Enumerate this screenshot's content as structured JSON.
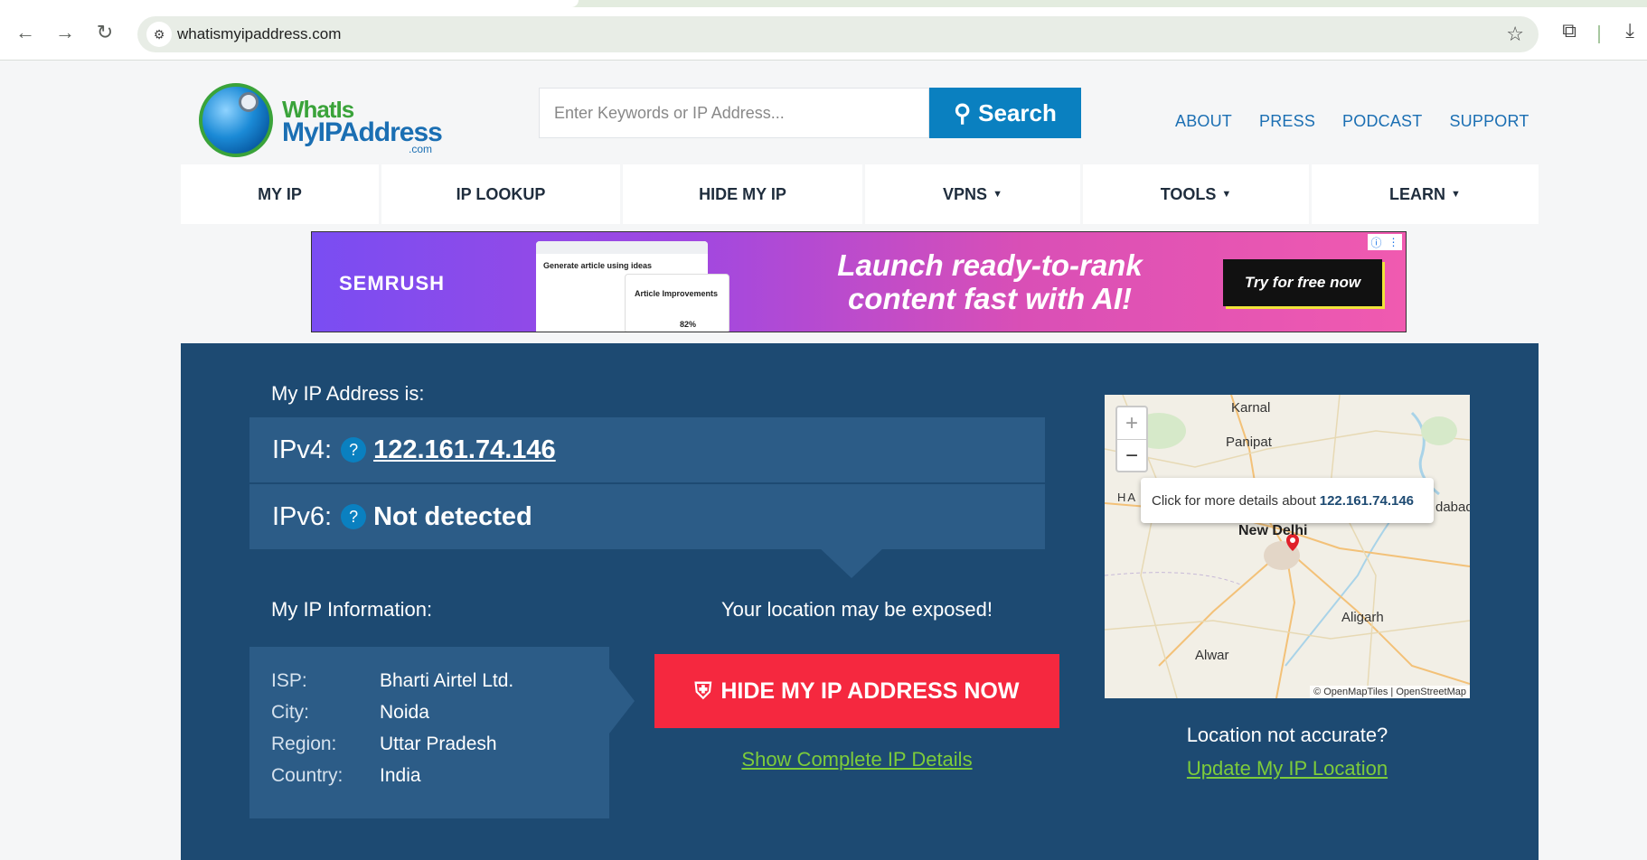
{
  "browser": {
    "url": "whatismyipaddress.com",
    "back_icon": "←",
    "forward_icon": "→",
    "reload_icon": "↻",
    "site_icon": "⚙",
    "star_icon": "☆",
    "extensions_icon": "⧉",
    "download_icon": "⤓"
  },
  "logo": {
    "line1": "WhatIs",
    "line2": "MyIPAddress",
    "line3": ".com"
  },
  "search": {
    "placeholder": "Enter Keywords or IP Address...",
    "button_label": "Search",
    "button_icon": "⚲"
  },
  "top_links": [
    "ABOUT",
    "PRESS",
    "PODCAST",
    "SUPPORT"
  ],
  "nav": [
    {
      "label": "MY IP",
      "caret": ""
    },
    {
      "label": "IP LOOKUP",
      "caret": ""
    },
    {
      "label": "HIDE MY IP",
      "caret": ""
    },
    {
      "label": "VPNS",
      "caret": "▼"
    },
    {
      "label": "TOOLS",
      "caret": "▼"
    },
    {
      "label": "LEARN",
      "caret": "▼"
    }
  ],
  "ad": {
    "brand": "SEMRUSH",
    "screenshot1_title": "Generate article using ideas",
    "screenshot2_title": "Article Improvements",
    "screenshot2_percent": "82%",
    "headline": "Launch ready-to-rank content fast with AI!",
    "cta": "Try for free now",
    "info_icon": "ⓘ",
    "menu_icon": "⋮"
  },
  "ip": {
    "heading": "My IP Address is:",
    "ipv4_label": "IPv4:",
    "ipv4_value": "122.161.74.146",
    "ipv6_label": "IPv6:",
    "ipv6_value": "Not detected",
    "help_icon": "?"
  },
  "info": {
    "heading": "My IP Information:",
    "rows": [
      {
        "key": "ISP:",
        "value": "Bharti Airtel Ltd."
      },
      {
        "key": "City:",
        "value": "Noida"
      },
      {
        "key": "Region:",
        "value": "Uttar Pradesh"
      },
      {
        "key": "Country:",
        "value": "India"
      }
    ]
  },
  "exposure": {
    "text": "Your location may be exposed!",
    "button_label": "HIDE MY IP ADDRESS NOW",
    "button_icon": "⛨",
    "details_link": "Show Complete IP Details"
  },
  "map": {
    "zoom_in": "+",
    "zoom_out": "−",
    "cities": [
      "Karnal",
      "Panipat",
      "New Delhi",
      "Aligarh",
      "Alwar",
      "HA",
      "dabad"
    ],
    "tooltip_text": "Click for more details about",
    "tooltip_ip": "122.161.74.146",
    "attribution": "© OpenMapTiles | OpenStreetMap"
  },
  "location": {
    "question": "Location not accurate?",
    "update_link": "Update My IP Location"
  },
  "colors": {
    "brand_blue": "#1d4a72",
    "accent_blue": "#0a80c0",
    "cta_red": "#f5283f",
    "link_green": "#7dcc3a"
  }
}
